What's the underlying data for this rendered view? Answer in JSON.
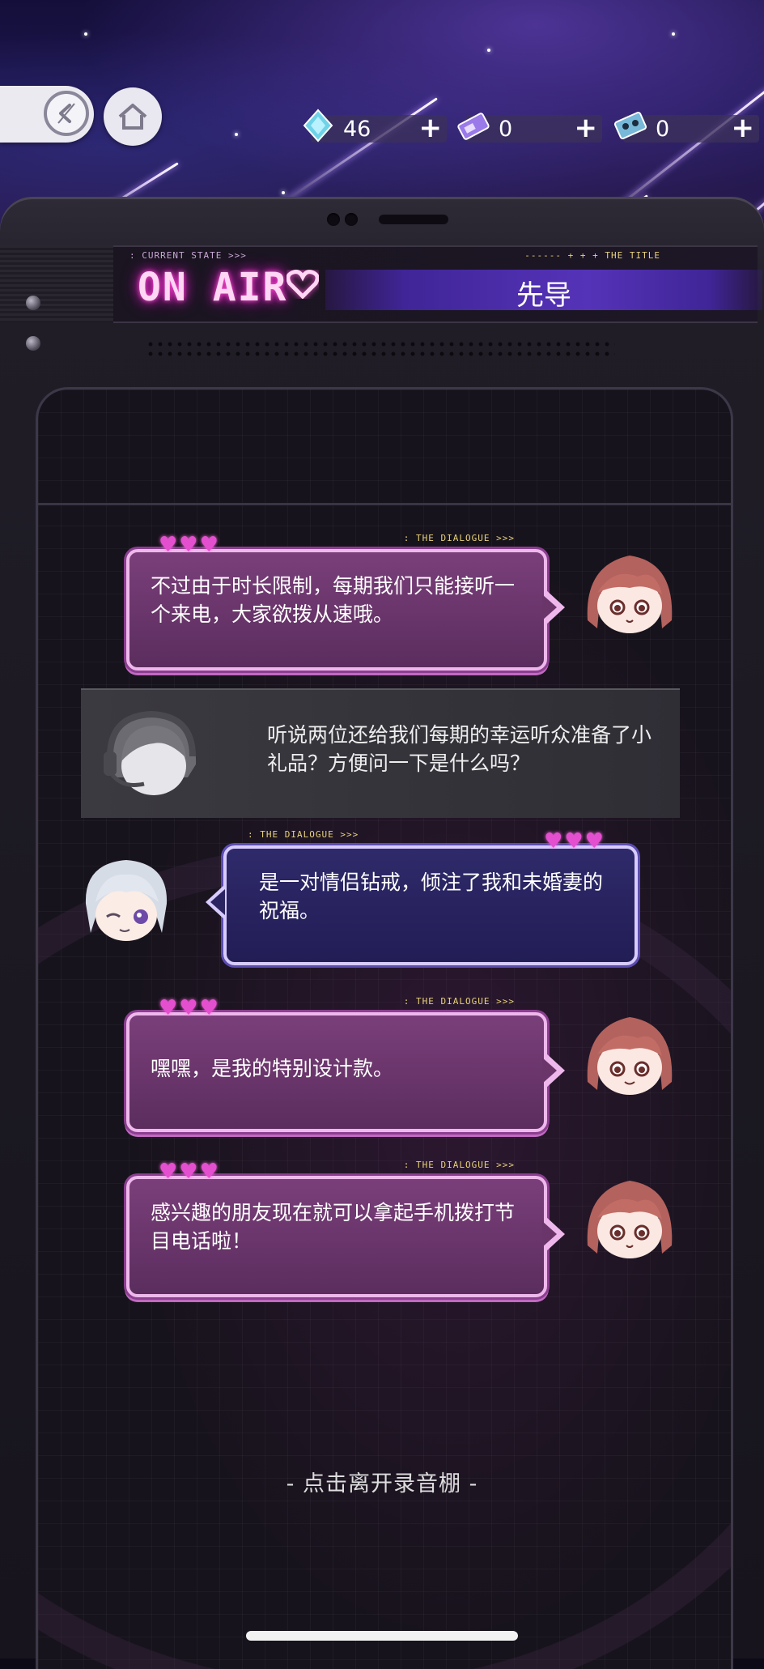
{
  "topbar": {
    "currencies": [
      {
        "icon": "diamond-icon",
        "value": "46",
        "plus": "+"
      },
      {
        "icon": "ticket-icon",
        "value": "0",
        "plus": "+"
      },
      {
        "icon": "cassette-icon",
        "value": "0",
        "plus": "+"
      }
    ]
  },
  "header": {
    "current_state_label": ": CURRENT STATE >>>",
    "title_label": "------   + + +  THE TITLE",
    "on_air": "ON AIR",
    "title": "先导"
  },
  "dialogue": [
    {
      "speaker": "girl",
      "tag": ": THE DIALOGUE >>>",
      "text": "不过由于时长限制，每期我们只能接听一个来电，大家欲拨从速哦。"
    },
    {
      "speaker": "host",
      "text": "听说两位还给我们每期的幸运听众准备了小礼品？方便问一下是什么吗？"
    },
    {
      "speaker": "boy",
      "tag": ": THE DIALOGUE >>>",
      "text": "是一对情侣钻戒，倾注了我和未婚妻的祝福。"
    },
    {
      "speaker": "girl",
      "tag": ": THE DIALOGUE >>>",
      "text": "嘿嘿，是我的特别设计款。"
    },
    {
      "speaker": "girl",
      "tag": ": THE DIALOGUE >>>",
      "text": "感兴趣的朋友现在就可以拿起手机拨打节目电话啦！"
    }
  ],
  "footer": {
    "exit_text": "- 点击离开录音棚 -"
  },
  "colors": {
    "pink_bubble": "#6a3569",
    "purple_bubble": "#2a2460",
    "neon_pink": "#ff4fd2"
  }
}
